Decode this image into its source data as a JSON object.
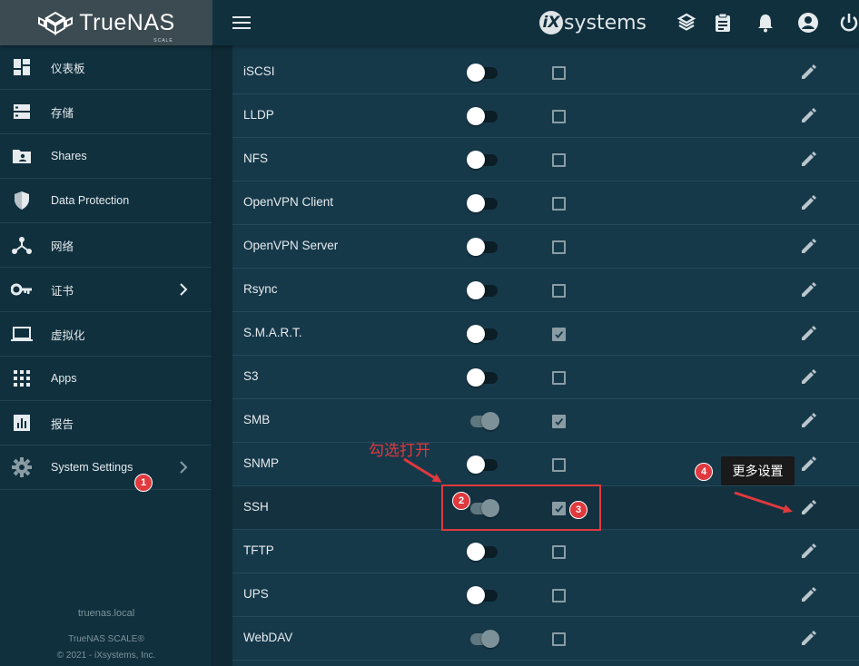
{
  "app": {
    "brand_name": "TrueNAS",
    "brand_sub": "SCALE",
    "vendor_logo": "systems",
    "vendor_logo_mark": "iX"
  },
  "topbar": {
    "icons": [
      "menu-icon",
      "truecommand-icon",
      "clipboard-icon",
      "bell-icon",
      "account-icon",
      "power-icon"
    ]
  },
  "sidebar": {
    "items": [
      {
        "label": "仪表板",
        "icon": "dashboard-icon"
      },
      {
        "label": "存储",
        "icon": "storage-icon"
      },
      {
        "label": "Shares",
        "icon": "folder-share-icon"
      },
      {
        "label": "Data Protection",
        "icon": "shield-icon"
      },
      {
        "label": "网络",
        "icon": "network-icon"
      },
      {
        "label": "证书",
        "icon": "key-icon",
        "has_chevron": true
      },
      {
        "label": "虚拟化",
        "icon": "laptop-icon"
      },
      {
        "label": "Apps",
        "icon": "apps-grid-icon"
      },
      {
        "label": "报告",
        "icon": "chart-icon"
      },
      {
        "label": "System Settings",
        "icon": "gear-icon",
        "has_chevron": true
      }
    ],
    "hostname": "truenas.local",
    "version": "TrueNAS SCALE®",
    "copyright": "© 2021 - iXsystems, Inc."
  },
  "services": [
    {
      "name": "iSCSI",
      "running": false,
      "start_auto": false
    },
    {
      "name": "LLDP",
      "running": false,
      "start_auto": false
    },
    {
      "name": "NFS",
      "running": false,
      "start_auto": false
    },
    {
      "name": "OpenVPN Client",
      "running": false,
      "start_auto": false
    },
    {
      "name": "OpenVPN Server",
      "running": false,
      "start_auto": false
    },
    {
      "name": "Rsync",
      "running": false,
      "start_auto": false
    },
    {
      "name": "S.M.A.R.T.",
      "running": false,
      "start_auto": true
    },
    {
      "name": "S3",
      "running": false,
      "start_auto": false
    },
    {
      "name": "SMB",
      "running": true,
      "start_auto": true
    },
    {
      "name": "SNMP",
      "running": false,
      "start_auto": false
    },
    {
      "name": "SSH",
      "running": true,
      "start_auto": true
    },
    {
      "name": "TFTP",
      "running": false,
      "start_auto": false
    },
    {
      "name": "UPS",
      "running": false,
      "start_auto": false
    },
    {
      "name": "WebDAV",
      "running": true,
      "start_auto": false
    }
  ],
  "annotations": {
    "check_open_text": "勾选打开",
    "more_settings_text": "更多设置",
    "badges": [
      "1",
      "2",
      "3",
      "4"
    ],
    "color": "#e0393e"
  },
  "colors": {
    "topbar": "#10303e",
    "logo_area": "#3c4b52",
    "card": "#16394a",
    "accent_red": "#e0393e"
  }
}
